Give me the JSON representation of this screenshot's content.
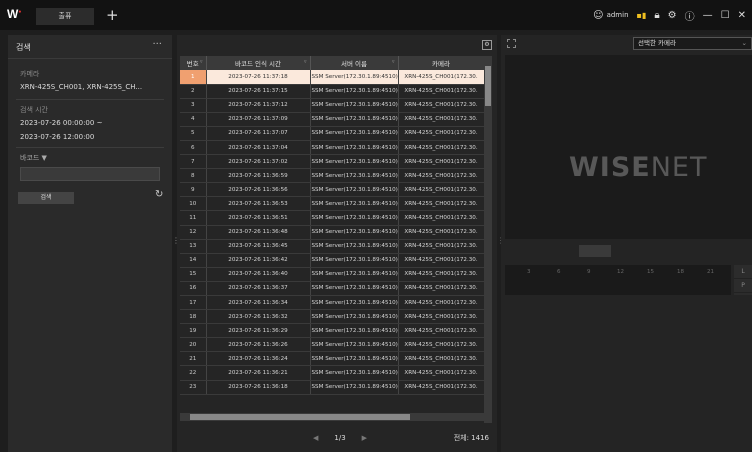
{
  "titlebar": {
    "logo": "W",
    "tab_label": "출퓨",
    "add_tab": "+",
    "user": "admin"
  },
  "left": {
    "title": "검색",
    "more": "···",
    "camera_label": "카메라",
    "camera_value": "XRN-425S_CH001, XRN-425S_CH...",
    "time_label": "검색 시간",
    "time_from": "2023-07-26 00:00:00 ~",
    "time_to": "2023-07-26 12:00:00",
    "barcode_label": "바코드 ▼",
    "barcode_value": "",
    "search_button": "검색"
  },
  "table": {
    "headers": [
      "번호",
      "바코드 인식 시간",
      "서버 이름",
      "카메라"
    ],
    "rows": [
      [
        "1",
        "2023-07-26 11:37:18",
        "SSM Server(172.30.1.89:4510)",
        "XRN-425S_CH001(172.30."
      ],
      [
        "2",
        "2023-07-26 11:37:15",
        "SSM Server(172.30.1.89:4510)",
        "XRN-425S_CH001(172.30."
      ],
      [
        "3",
        "2023-07-26 11:37:12",
        "SSM Server(172.30.1.89:4510)",
        "XRN-425S_CH001(172.30."
      ],
      [
        "4",
        "2023-07-26 11:37:09",
        "SSM Server(172.30.1.89:4510)",
        "XRN-425S_CH001(172.30."
      ],
      [
        "5",
        "2023-07-26 11:37:07",
        "SSM Server(172.30.1.89:4510)",
        "XRN-425S_CH001(172.30."
      ],
      [
        "6",
        "2023-07-26 11:37:04",
        "SSM Server(172.30.1.89:4510)",
        "XRN-425S_CH001(172.30."
      ],
      [
        "7",
        "2023-07-26 11:37:02",
        "SSM Server(172.30.1.89:4510)",
        "XRN-425S_CH001(172.30."
      ],
      [
        "8",
        "2023-07-26 11:36:59",
        "SSM Server(172.30.1.89:4510)",
        "XRN-425S_CH001(172.30."
      ],
      [
        "9",
        "2023-07-26 11:36:56",
        "SSM Server(172.30.1.89:4510)",
        "XRN-425S_CH001(172.30."
      ],
      [
        "10",
        "2023-07-26 11:36:53",
        "SSM Server(172.30.1.89:4510)",
        "XRN-425S_CH001(172.30."
      ],
      [
        "11",
        "2023-07-26 11:36:51",
        "SSM Server(172.30.1.89:4510)",
        "XRN-425S_CH001(172.30."
      ],
      [
        "12",
        "2023-07-26 11:36:48",
        "SSM Server(172.30.1.89:4510)",
        "XRN-425S_CH001(172.30."
      ],
      [
        "13",
        "2023-07-26 11:36:45",
        "SSM Server(172.30.1.89:4510)",
        "XRN-425S_CH001(172.30."
      ],
      [
        "14",
        "2023-07-26 11:36:42",
        "SSM Server(172.30.1.89:4510)",
        "XRN-425S_CH001(172.30."
      ],
      [
        "15",
        "2023-07-26 11:36:40",
        "SSM Server(172.30.1.89:4510)",
        "XRN-425S_CH001(172.30."
      ],
      [
        "16",
        "2023-07-26 11:36:37",
        "SSM Server(172.30.1.89:4510)",
        "XRN-425S_CH001(172.30."
      ],
      [
        "17",
        "2023-07-26 11:36:34",
        "SSM Server(172.30.1.89:4510)",
        "XRN-425S_CH001(172.30."
      ],
      [
        "18",
        "2023-07-26 11:36:32",
        "SSM Server(172.30.1.89:4510)",
        "XRN-425S_CH001(172.30."
      ],
      [
        "19",
        "2023-07-26 11:36:29",
        "SSM Server(172.30.1.89:4510)",
        "XRN-425S_CH001(172.30."
      ],
      [
        "20",
        "2023-07-26 11:36:26",
        "SSM Server(172.30.1.89:4510)",
        "XRN-425S_CH001(172.30."
      ],
      [
        "21",
        "2023-07-26 11:36:24",
        "SSM Server(172.30.1.89:4510)",
        "XRN-425S_CH001(172.30."
      ],
      [
        "22",
        "2023-07-26 11:36:21",
        "SSM Server(172.30.1.89:4510)",
        "XRN-425S_CH001(172.30."
      ],
      [
        "23",
        "2023-07-26 11:36:18",
        "SSM Server(172.30.1.89:4510)",
        "XRN-425S_CH001(172.30."
      ]
    ],
    "selected_row": 0
  },
  "pager": {
    "page": "1/3",
    "total": "전체: 1416"
  },
  "right": {
    "camera_select": "선택한 카메라",
    "brand_a": "WISE",
    "brand_b": "NET",
    "timeline_ticks": [
      "3",
      "6",
      "9",
      "12",
      "15",
      "18",
      "21"
    ],
    "side_btn_1": "L",
    "side_btn_2": "P"
  },
  "colors": {
    "selected_row_bg": "#fbe9dc",
    "selected_num_bg": "#f0a070",
    "accent": "#f0c020"
  }
}
